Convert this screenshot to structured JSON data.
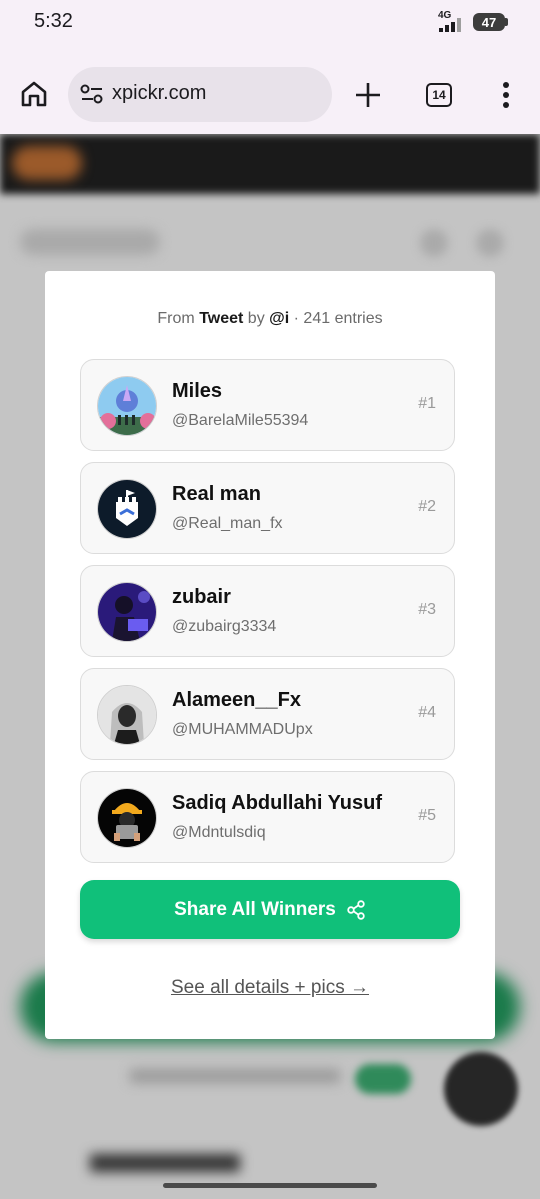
{
  "status_bar": {
    "time": "5:32",
    "network": "4G",
    "battery": "47"
  },
  "browser": {
    "url": "xpickr.com",
    "tab_count": "14",
    "icons": [
      "home-icon",
      "site-settings-icon",
      "plus-icon",
      "tabs-icon",
      "more-vert-icon"
    ]
  },
  "modal": {
    "subtitle": {
      "from": "From",
      "source": "Tweet",
      "by": "by",
      "author": "@i",
      "entries": "· 241 entries"
    },
    "winners": [
      {
        "name": "Miles",
        "handle": "@BarelaMile55394",
        "rank": "#1"
      },
      {
        "name": "Real man",
        "handle": "@Real_man_fx",
        "rank": "#2"
      },
      {
        "name": "zubair",
        "handle": "@zubairg3334",
        "rank": "#3"
      },
      {
        "name": "Alameen__Fx",
        "handle": "@MUHAMMADUpx",
        "rank": "#4"
      },
      {
        "name": "Sadiq Abdullahi Yusuf",
        "handle": "@Mdntulsdiq",
        "rank": "#5"
      }
    ],
    "share_label": "Share All Winners",
    "details_label": "See all details + pics →"
  },
  "colors": {
    "accent": "#10c07a",
    "browser_bg": "#f7f0f8"
  }
}
